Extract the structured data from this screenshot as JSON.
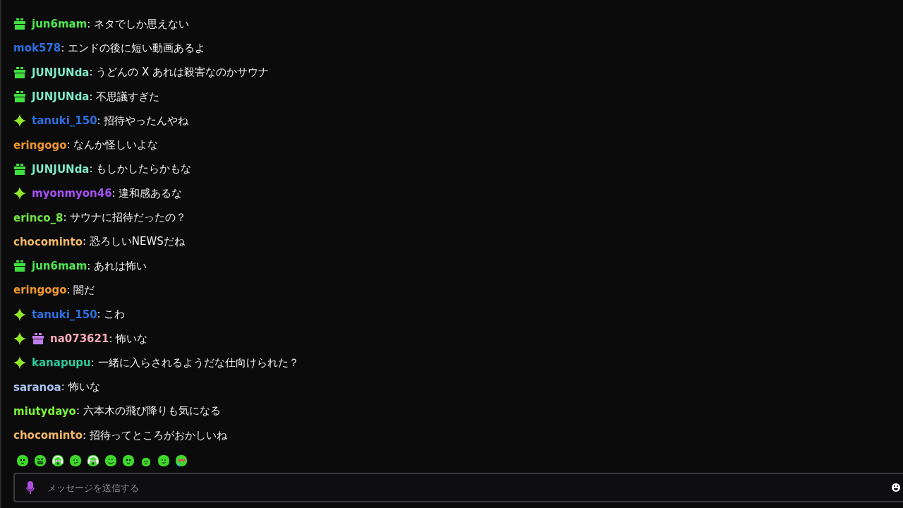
{
  "messages": [
    {
      "badges": [
        {
          "kind": "gift",
          "color": "#3fe03f"
        }
      ],
      "user": "jun6mam",
      "color": "#4fe84f",
      "text": ": ネタでしか思えない"
    },
    {
      "user": "mok578",
      "color": "#2f6fe0",
      "text": ": エンドの後に短い動画あるよ"
    },
    {
      "badges": [
        {
          "kind": "gift",
          "color": "#3fe03f"
        }
      ],
      "user": "JUNJUNda",
      "color": "#7fe8c8",
      "text": ": うどんの X あれは殺害なのかサウナ"
    },
    {
      "badges": [
        {
          "kind": "gift",
          "color": "#3fe03f"
        }
      ],
      "user": "JUNJUNda",
      "color": "#7fe8c8",
      "text": ": 不思議すぎた"
    },
    {
      "badges": [
        {
          "kind": "sparkle"
        }
      ],
      "user": "tanuki_150",
      "color": "#2f6fe0",
      "text": ": 招待やったんやね"
    },
    {
      "user": "eringogo",
      "color": "#f0962e",
      "text": ": なんか怪しいよな"
    },
    {
      "badges": [
        {
          "kind": "gift",
          "color": "#3fe03f"
        }
      ],
      "user": "JUNJUNda",
      "color": "#7fe8c8",
      "text": ": もしかしたらかもな"
    },
    {
      "badges": [
        {
          "kind": "sparkle"
        }
      ],
      "user": "myonmyon46",
      "color": "#a54ff5",
      "text": ": 違和感あるな"
    },
    {
      "user": "erinco_8",
      "color": "#72e444",
      "text": ": サウナに招待だったの？"
    },
    {
      "user": "chocominto",
      "color": "#f2b866",
      "text": ": 恐ろしいNEWSだね"
    },
    {
      "badges": [
        {
          "kind": "gift",
          "color": "#3fe03f"
        }
      ],
      "user": "jun6mam",
      "color": "#4fe84f",
      "text": ": あれは怖い"
    },
    {
      "user": "eringogo",
      "color": "#f0962e",
      "text": ": 闇だ"
    },
    {
      "badges": [
        {
          "kind": "sparkle"
        }
      ],
      "user": "tanuki_150",
      "color": "#2f6fe0",
      "text": ": こわ"
    },
    {
      "badges": [
        {
          "kind": "sparkle"
        },
        {
          "kind": "gift",
          "color": "#c27ee8"
        }
      ],
      "user": "na073621",
      "color": "#f4a8b8",
      "text": ": 怖いな"
    },
    {
      "badges": [
        {
          "kind": "sparkle"
        }
      ],
      "user": "kanapupu",
      "color": "#2ecb9c",
      "text": ": 一緒に入らされるようだな仕向けられた？"
    },
    {
      "user": "saranoa",
      "color": "#a8c4f0",
      "text": ": 怖いな"
    },
    {
      "user": "miutydayo",
      "color": "#7cf038",
      "text": ": 六本木の飛び降りも気になる"
    },
    {
      "user": "chocominto",
      "color": "#f2b866",
      "text": ": 招待ってところがおかしいね"
    }
  ],
  "emotes": [
    {
      "kind": "happy"
    },
    {
      "kind": "angry"
    },
    {
      "kind": "headset"
    },
    {
      "kind": "smirk"
    },
    {
      "kind": "headset"
    },
    {
      "kind": "grin"
    },
    {
      "kind": "happy"
    },
    {
      "kind": "small"
    },
    {
      "kind": "smirk"
    },
    {
      "kind": "heart"
    }
  ],
  "input": {
    "placeholder": "メッセージを送信する"
  }
}
